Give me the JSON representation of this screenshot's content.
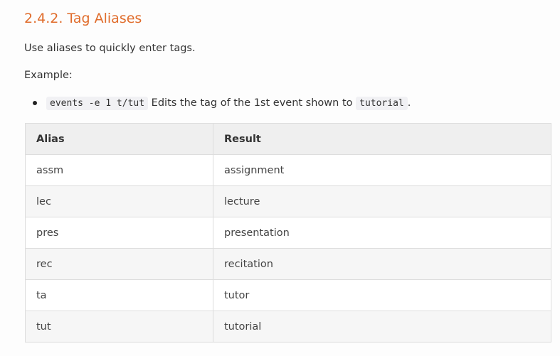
{
  "heading": "2.4.2. Tag Aliases",
  "intro": "Use aliases to quickly enter tags.",
  "example_label": "Example:",
  "example_item": {
    "code": "events -e 1 t/tut",
    "text": " Edits the tag of the 1st event shown to ",
    "code2": "tutorial",
    "tail": "."
  },
  "table": {
    "headers": [
      "Alias",
      "Result"
    ],
    "rows": [
      {
        "alias": "assm",
        "result": "assignment"
      },
      {
        "alias": "lec",
        "result": "lecture"
      },
      {
        "alias": "pres",
        "result": "presentation"
      },
      {
        "alias": "rec",
        "result": "recitation"
      },
      {
        "alias": "ta",
        "result": "tutor"
      },
      {
        "alias": "tut",
        "result": "tutorial"
      }
    ]
  },
  "colors": {
    "heading": "#e06c2b",
    "text": "#333333",
    "code_bg": "#f1f1f4",
    "table_border": "#dddddd",
    "header_bg": "#efefef",
    "stripe_bg": "#f6f6f6"
  }
}
